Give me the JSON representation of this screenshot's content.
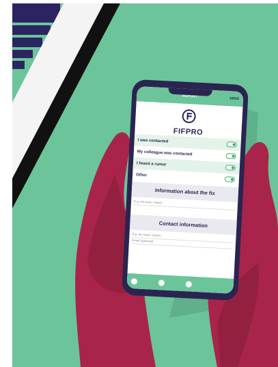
{
  "phone": {
    "header": {
      "title": "REPORT",
      "send_label": "SEND"
    },
    "brand": {
      "logo_text": "FIFPRO"
    },
    "report_options": [
      {
        "label": "I was contacted",
        "toggle_on": true
      },
      {
        "label": "My colleague was contacted",
        "toggle_on": true
      },
      {
        "label": "I heard a rumor",
        "toggle_on": true
      },
      {
        "label": "Other",
        "toggle_on": true
      }
    ],
    "info_section": {
      "title": "Information about the fix",
      "placeholder": "E.g. the team, match..."
    },
    "contact_section": {
      "title": "Contact information",
      "field1_placeholder": "E.g. the team, match...",
      "field2_placeholder": "Email (optional)"
    }
  },
  "colors": {
    "background_green": "#6cc49a",
    "hand_red": "#a8244a",
    "phone_navy": "#2a2550",
    "stripe_navy": "#2a2560"
  },
  "icons": [
    "fifpro-logo-icon",
    "toggle-switch-icon"
  ]
}
